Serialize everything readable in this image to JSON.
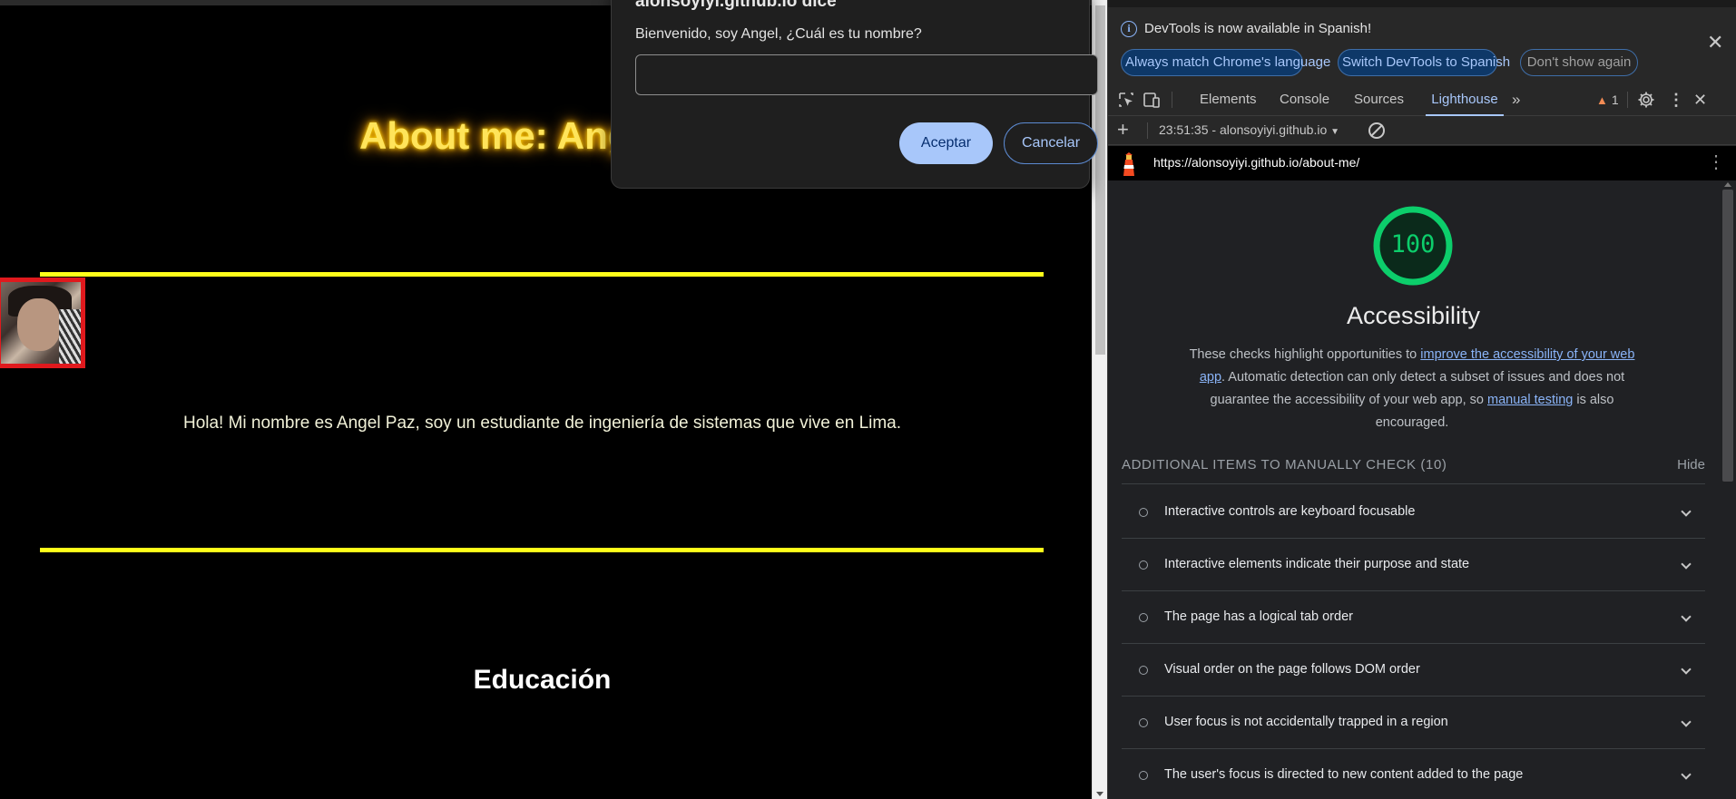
{
  "page": {
    "title": "About me: Angel Paz",
    "intro": "Hola! Mi nombre es Angel Paz, soy un estudiante de ingeniería de sistemas que vive en Lima.",
    "education_heading": "Educación",
    "accent_color": "#ffff1a",
    "avatar_border_color": "#e0191d"
  },
  "dialog": {
    "title": "alonsoyiyi.github.io dice",
    "message": "Bienvenido, soy Angel, ¿Cuál es tu nombre?",
    "input_value": "",
    "accept_label": "Aceptar",
    "cancel_label": "Cancelar"
  },
  "devtools": {
    "infobar": {
      "message": "DevTools is now available in Spanish!",
      "match_language_label": "Always match Chrome's language",
      "switch_label": "Switch DevTools to Spanish",
      "dont_show_label": "Don't show again"
    },
    "tabs": [
      {
        "label": "Elements"
      },
      {
        "label": "Console"
      },
      {
        "label": "Sources"
      },
      {
        "label": "Lighthouse",
        "active": true
      }
    ],
    "warning_count": "1",
    "lighthouse": {
      "report_label": "23:51:35 - alonsoyiyi.github.io",
      "url": "https://alonsoyiyi.github.io/about-me/",
      "score": "100",
      "score_fraction": 1.0,
      "score_color": "#0cce6b",
      "category_title": "Accessibility",
      "desc_part1": "These checks highlight opportunities to ",
      "desc_link1": "improve the accessibility of your web app",
      "desc_part2": ". Automatic detection can only detect a subset of issues and does not guarantee the accessibility of your web app, so ",
      "desc_link2": "manual testing",
      "desc_part3": " is also encouraged.",
      "manual_header": "ADDITIONAL ITEMS TO MANUALLY CHECK (10)",
      "hide_label": "Hide",
      "audits": [
        "Interactive controls are keyboard focusable",
        "Interactive elements indicate their purpose and state",
        "The page has a logical tab order",
        "Visual order on the page follows DOM order",
        "User focus is not accidentally trapped in a region",
        "The user's focus is directed to new content added to the page"
      ]
    }
  }
}
